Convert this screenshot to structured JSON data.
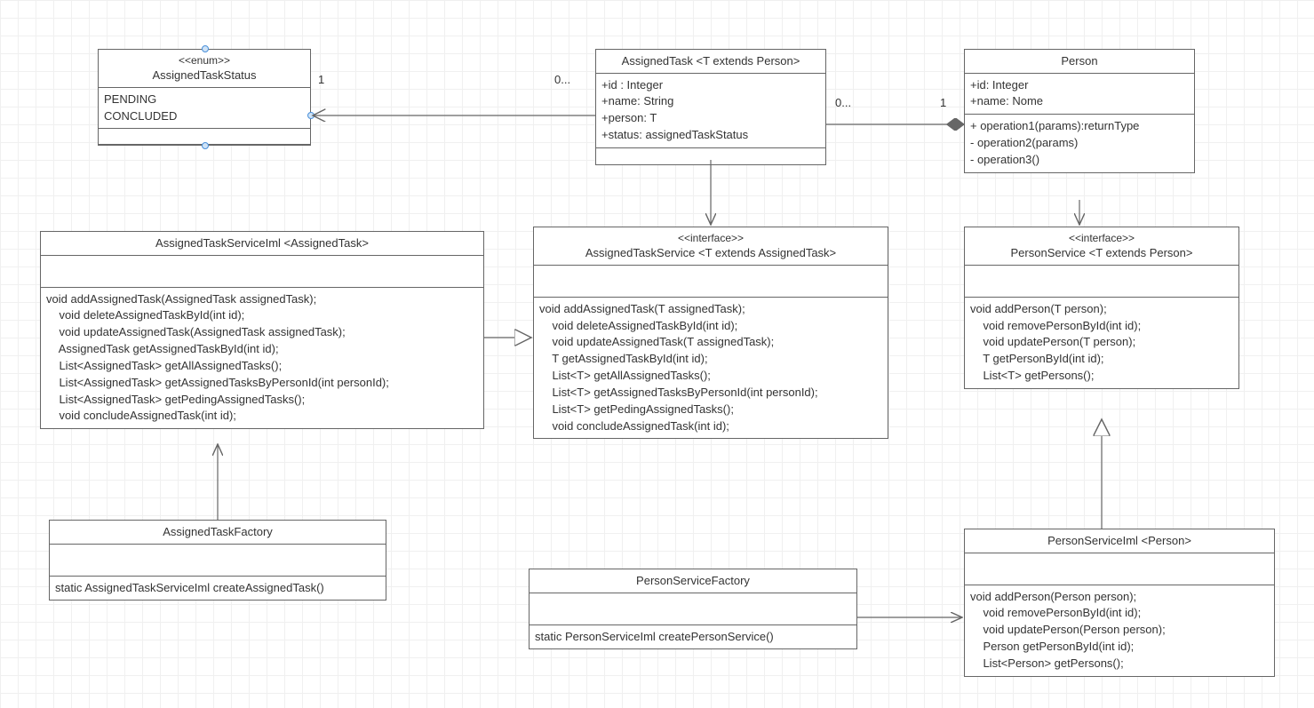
{
  "classes": {
    "enumStatus": {
      "stereotype": "<<enum>>",
      "name": "AssignedTaskStatus",
      "attrs": "PENDING\nCONCLUDED",
      "ops": ""
    },
    "assignedTask": {
      "name": "AssignedTask <T extends Person>",
      "attrs": "+id : Integer\n+name: String\n+person: T\n+status: assignedTaskStatus",
      "ops": ""
    },
    "person": {
      "name": "Person",
      "attrs": "+id: Integer\n+name: Nome",
      "ops": "+ operation1(params):returnType\n- operation2(params)\n- operation3()"
    },
    "assignedTaskServiceImpl": {
      "name": "AssignedTaskServiceIml <AssignedTask>",
      "attrs": "",
      "ops": "void addAssignedTask(AssignedTask assignedTask);\n    void deleteAssignedTaskById(int id);\n    void updateAssignedTask(AssignedTask assignedTask);\n    AssignedTask getAssignedTaskById(int id);\n    List<AssignedTask> getAllAssignedTasks();\n    List<AssignedTask> getAssignedTasksByPersonId(int personId);\n    List<AssignedTask> getPedingAssignedTasks();\n    void concludeAssignedTask(int id);"
    },
    "assignedTaskService": {
      "stereotype": "<<interface>>",
      "name": "AssignedTaskService <T extends AssignedTask>",
      "attrs": "",
      "ops": "void addAssignedTask(T assignedTask);\n    void deleteAssignedTaskById(int id);\n    void updateAssignedTask(T assignedTask);\n    T getAssignedTaskById(int id);\n    List<T> getAllAssignedTasks();\n    List<T> getAssignedTasksByPersonId(int personId);\n    List<T> getPedingAssignedTasks();\n    void concludeAssignedTask(int id);"
    },
    "personService": {
      "stereotype": "<<interface>>",
      "name": "PersonService <T extends Person>",
      "attrs": "",
      "ops": "void addPerson(T person);\n    void removePersonById(int id);\n    void updatePerson(T person);\n    T getPersonById(int id);\n    List<T> getPersons();"
    },
    "assignedTaskFactory": {
      "name": "AssignedTaskFactory",
      "attrs": "",
      "ops": "static AssignedTaskServiceIml createAssignedTask()"
    },
    "personServiceFactory": {
      "name": "PersonServiceFactory",
      "attrs": "",
      "ops": "static PersonServiceIml createPersonService()"
    },
    "personServiceImpl": {
      "name": "PersonServiceIml <Person>",
      "attrs": "",
      "ops": "void addPerson(Person person);\n    void removePersonById(int id);\n    void updatePerson(Person person);\n    Person getPersonById(int id);\n    List<Person> getPersons();"
    }
  },
  "multiplicities": {
    "enum_one": "1",
    "task_zeroMany_left": "0...",
    "task_zeroMany_right": "0...",
    "person_one": "1"
  },
  "styles": {
    "border": "#666666",
    "grid": "#f0f0f0",
    "handle_fill": "#cfe3f7",
    "handle_stroke": "#4a90d9"
  }
}
